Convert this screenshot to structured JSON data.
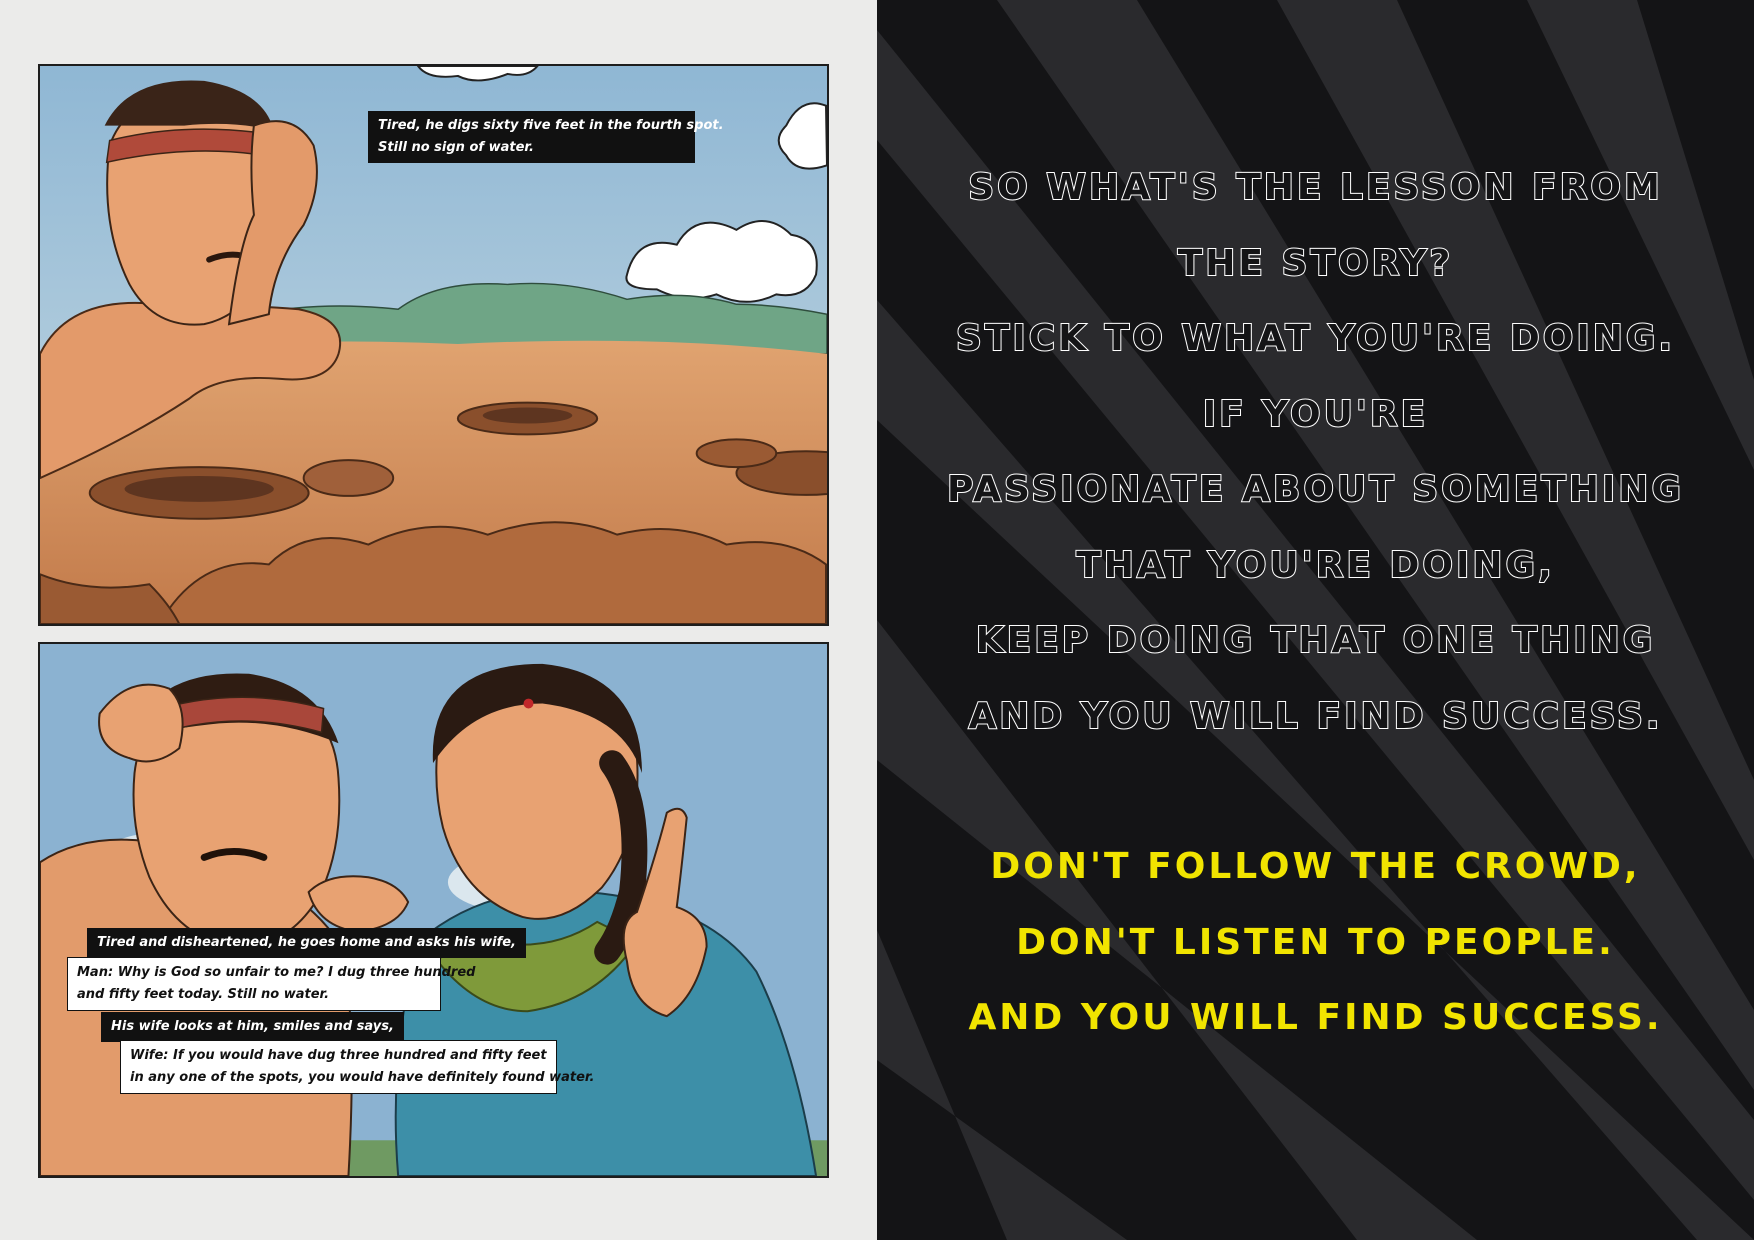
{
  "left_page": {
    "panel_top": {
      "caption_lines": [
        "Tired, he digs sixty five feet in the fourth spot.",
        "Still no sign of water."
      ]
    },
    "panel_bottom": {
      "narration_1": "Tired and disheartened, he goes home and asks his wife,",
      "man_lines": [
        "Man: Why is God so unfair to me? I dug three hundred",
        "and fifty feet today. Still no water."
      ],
      "narration_2": "His wife looks at him, smiles and says,",
      "wife_lines": [
        "Wife: If you would have dug three hundred and fifty feet",
        "in any one of the spots, you would have definitely found water."
      ]
    }
  },
  "right_page": {
    "lesson_lines": [
      "So what's the lesson from",
      "the story?",
      "Stick to what you're doing.",
      "If you're",
      "passionate about something",
      "that you're doing,",
      "keep doing that one thing",
      "and you will find success."
    ],
    "highlight_lines": [
      "Don't follow the crowd,",
      "don't listen to people.",
      "And you will find success."
    ],
    "colors": {
      "background": "#141416",
      "ray": "#2a2a2d",
      "lesson_text": "#ffffff",
      "highlight_text": "#f1e400"
    }
  }
}
